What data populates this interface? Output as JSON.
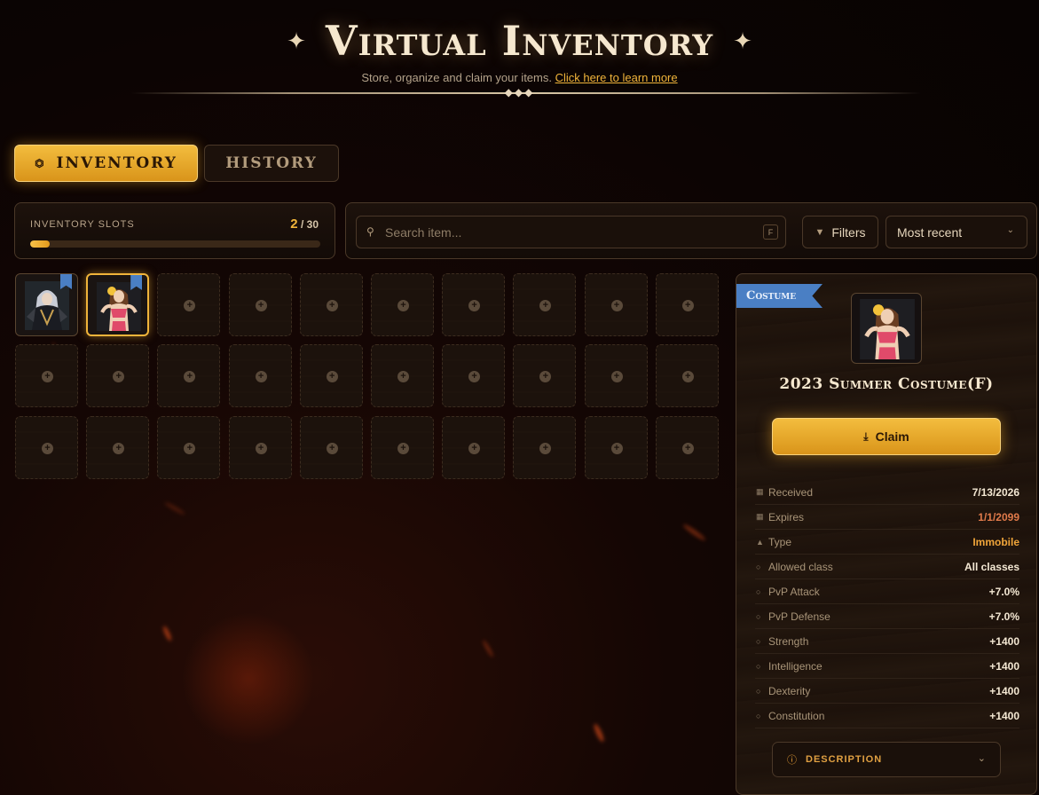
{
  "header": {
    "title": "Virtual Inventory",
    "subtitle": "Store, organize and claim your items.",
    "learn_more": "Click here to learn more"
  },
  "tabs": [
    {
      "label": "INVENTORY",
      "active": true,
      "icon": "chest-icon"
    },
    {
      "label": "HISTORY",
      "active": false
    }
  ],
  "slots": {
    "label": "INVENTORY SLOTS",
    "used": "2",
    "separator": "/",
    "total": "30",
    "fill_fraction": 0.0667
  },
  "search": {
    "placeholder": "Search item...",
    "shortcut": "F",
    "filters_label": "Filters",
    "sort_value": "Most recent"
  },
  "grid": {
    "items": [
      {
        "name": "dark-costume-item",
        "filled": true,
        "selected": false
      },
      {
        "name": "summer-costume-item",
        "filled": true,
        "selected": true
      }
    ],
    "empty_slots": 28
  },
  "detail": {
    "category": "Costume",
    "item_name": "2023 Summer Costume(F)",
    "claim_label": "Claim",
    "stats": [
      {
        "icon": "calendar-icon",
        "label": "Received",
        "value": "7/13/2026",
        "tone": "white"
      },
      {
        "icon": "calendar-x-icon",
        "label": "Expires",
        "value": "1/1/2099",
        "tone": "orange"
      },
      {
        "icon": "lock-icon",
        "label": "Type",
        "value": "Immobile",
        "tone": "gold"
      },
      {
        "icon": "circle-icon",
        "label": "Allowed class",
        "value": "All classes",
        "tone": "white"
      },
      {
        "icon": "circle-icon",
        "label": "PvP Attack",
        "value": "+7.0%",
        "tone": "white"
      },
      {
        "icon": "circle-icon",
        "label": "PvP Defense",
        "value": "+7.0%",
        "tone": "white"
      },
      {
        "icon": "circle-icon",
        "label": "Strength",
        "value": "+1400",
        "tone": "white"
      },
      {
        "icon": "circle-icon",
        "label": "Intelligence",
        "value": "+1400",
        "tone": "white"
      },
      {
        "icon": "circle-icon",
        "label": "Dexterity",
        "value": "+1400",
        "tone": "white"
      },
      {
        "icon": "circle-icon",
        "label": "Constitution",
        "value": "+1400",
        "tone": "white"
      }
    ],
    "description_label": "DESCRIPTION"
  },
  "colors": {
    "accent": "#f0b43a",
    "ribbon": "#4a7fc4",
    "expires": "#e07a4a",
    "type": "#f0a53a"
  }
}
